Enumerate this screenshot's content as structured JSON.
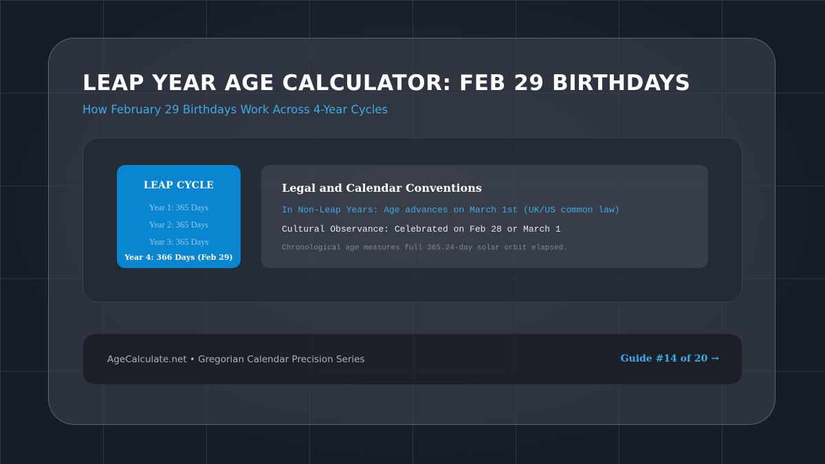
{
  "header": {
    "title": "LEAP YEAR AGE CALCULATOR: FEB 29 BIRTHDAYS",
    "subtitle": "How February 29 Birthdays Work Across 4-Year Cycles"
  },
  "leap_cycle": {
    "title": "LEAP CYCLE",
    "lines": [
      "Year 1: 365 Days",
      "Year 2: 365 Days",
      "Year 3: 365 Days",
      "Year 4: 366 Days (Feb 29)"
    ]
  },
  "conventions": {
    "title": "Legal and Calendar Conventions",
    "lines": [
      "In Non-Leap Years: Age advances on March 1st (UK/US common law)",
      "Cultural Observance: Celebrated on Feb 28 or March 1",
      "Chronological age measures full 365.24-day solar orbit elapsed."
    ]
  },
  "footer": {
    "left": "AgeCalculate.net • Gregorian Calendar Precision Series",
    "right": "Guide #14 of 20 →"
  },
  "colors": {
    "background": "#171d27",
    "accent": "#3fa9e6",
    "cycle_box": "#0a86d0"
  }
}
